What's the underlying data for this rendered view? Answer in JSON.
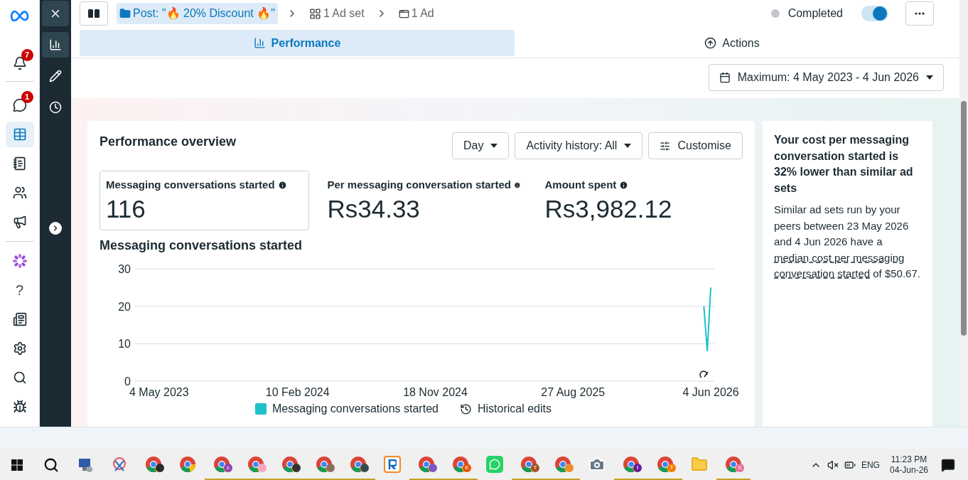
{
  "left_nav": {
    "items": [
      {
        "kind": "logo",
        "selected": false
      },
      {
        "kind": "bell",
        "badge": "7",
        "selected": false
      },
      {
        "kind": "chat",
        "badge": "1",
        "selected": false
      },
      {
        "kind": "table",
        "selected": true
      },
      {
        "kind": "notebook",
        "selected": false
      },
      {
        "kind": "people",
        "selected": false
      },
      {
        "kind": "megaphone",
        "selected": false
      },
      {
        "kind": "flower",
        "selected": false
      },
      {
        "kind": "glyph",
        "glyph": "?",
        "selected": false
      },
      {
        "kind": "news",
        "selected": false
      },
      {
        "kind": "gear",
        "selected": false
      },
      {
        "kind": "search",
        "selected": false
      },
      {
        "kind": "bug",
        "selected": false
      }
    ]
  },
  "rail": {
    "items": [
      {
        "kind": "chart",
        "selected": true
      },
      {
        "kind": "pencil",
        "selected": false
      },
      {
        "kind": "clock",
        "selected": false
      }
    ]
  },
  "breadcrumb": [
    {
      "kind": "post",
      "label": "Post: \"🔥 20% Discount 🔥\"",
      "selected": true
    },
    {
      "kind": "adset",
      "label": "1 Ad set",
      "selected": false
    },
    {
      "kind": "ad",
      "label": "1 Ad",
      "selected": false
    }
  ],
  "status": {
    "label": "Completed",
    "on": true
  },
  "tabs": [
    {
      "kind": "chart",
      "label": "Performance",
      "selected": true
    },
    {
      "kind": "up",
      "label": "Actions",
      "selected": false
    }
  ],
  "date_range": "Maximum: 4 May 2023 - 4 Jun 2026",
  "overview": {
    "title": "Performance overview",
    "controls": [
      {
        "kind": "dropdown",
        "label": "Day"
      },
      {
        "kind": "dropdown",
        "label": "Activity history: All"
      },
      {
        "kind": "button",
        "label": "Customise"
      }
    ],
    "metrics": [
      {
        "label": "Messaging conversations started",
        "value": "116",
        "selected": true
      },
      {
        "label": "Per messaging conversation started",
        "value": "Rs34.33",
        "selected": false
      },
      {
        "label": "Amount spent",
        "value": "Rs3,982.12",
        "selected": false
      }
    ],
    "chart_title": "Messaging conversations started",
    "chart_data": {
      "type": "line",
      "categories": [
        "4 May 2023",
        null,
        null,
        null,
        null,
        null,
        null,
        null,
        null,
        null,
        null,
        null,
        null,
        null,
        null,
        null,
        null,
        null,
        null,
        null,
        null,
        null,
        null,
        null,
        null,
        null,
        null,
        null,
        null,
        null,
        null,
        null,
        null,
        null,
        null,
        null,
        null,
        null,
        null,
        null,
        "10 Feb 2024",
        null,
        null,
        null,
        null,
        null,
        null,
        null,
        null,
        null,
        null,
        null,
        null,
        null,
        null,
        null,
        null,
        null,
        null,
        null,
        null,
        null,
        null,
        null,
        null,
        null,
        null,
        null,
        null,
        null,
        null,
        null,
        null,
        null,
        null,
        null,
        null,
        null,
        null,
        null,
        "18 Nov 2024",
        null,
        null,
        null,
        null,
        null,
        null,
        null,
        null,
        null,
        null,
        null,
        null,
        null,
        null,
        null,
        null,
        null,
        null,
        null,
        null,
        null,
        null,
        null,
        null,
        null,
        null,
        null,
        null,
        null,
        null,
        null,
        null,
        null,
        null,
        null,
        null,
        null,
        null,
        null,
        "27 Aug 2025",
        null,
        null,
        null,
        null,
        null,
        null,
        null,
        null,
        null,
        null,
        null,
        null,
        null,
        null,
        null,
        null,
        null,
        null,
        null,
        null,
        null,
        null,
        null,
        null,
        null,
        null,
        null,
        null,
        null,
        null,
        null,
        null,
        null,
        null,
        null,
        null,
        null,
        null,
        null,
        "4 Jun 2026"
      ],
      "yticks": [
        0,
        10,
        20,
        30
      ],
      "ylim": [
        0,
        30
      ],
      "series": [
        {
          "name": "Messaging conversations started",
          "color": "#1fc1c9",
          "values": [
            null,
            null,
            null,
            null,
            null,
            null,
            null,
            null,
            null,
            null,
            null,
            null,
            null,
            null,
            null,
            null,
            null,
            null,
            null,
            null,
            null,
            null,
            null,
            null,
            null,
            null,
            null,
            null,
            null,
            null,
            null,
            null,
            null,
            null,
            null,
            null,
            null,
            null,
            null,
            null,
            null,
            null,
            null,
            null,
            null,
            null,
            null,
            null,
            null,
            null,
            null,
            null,
            null,
            null,
            null,
            null,
            null,
            null,
            null,
            null,
            null,
            null,
            null,
            null,
            null,
            null,
            null,
            null,
            null,
            null,
            null,
            null,
            null,
            null,
            null,
            null,
            null,
            null,
            null,
            null,
            null,
            null,
            null,
            null,
            null,
            null,
            null,
            null,
            null,
            null,
            null,
            null,
            null,
            null,
            null,
            null,
            null,
            null,
            null,
            null,
            null,
            null,
            null,
            null,
            null,
            null,
            null,
            null,
            null,
            null,
            null,
            null,
            null,
            null,
            null,
            null,
            null,
            null,
            null,
            null,
            null,
            null,
            null,
            null,
            null,
            null,
            null,
            null,
            null,
            null,
            null,
            null,
            null,
            null,
            null,
            null,
            null,
            null,
            null,
            null,
            null,
            null,
            null,
            null,
            null,
            null,
            null,
            null,
            null,
            null,
            null,
            null,
            null,
            null,
            null,
            null,
            null,
            null,
            20,
            8,
            25
          ]
        }
      ]
    },
    "legend_history": "Historical edits"
  },
  "insight": {
    "title": "Your cost per messaging conversation started is 32% lower than similar ad sets",
    "body": "Similar ad sets run by your peers between 23 May 2026 and 4 Jun 2026 have a",
    "link": [
      "median cost per messaging",
      "conversation started"
    ],
    "tail": "of $50.67."
  },
  "taskbar": {
    "apps": [
      {
        "kind": "browser",
        "color": "#2b2b2b",
        "open": false
      },
      {
        "kind": "browser",
        "open": false
      },
      {
        "kind": "browser",
        "color": "#8e44ad",
        "badge": "c",
        "open": true
      },
      {
        "kind": "browser",
        "color": "#f4a6c0",
        "open": true
      },
      {
        "kind": "browser",
        "color": "#333333",
        "open": true
      },
      {
        "kind": "browser",
        "color": "#8d6e63",
        "open": true
      },
      {
        "kind": "browser",
        "color": "#37474f",
        "open": true
      },
      {
        "kind": "r-app",
        "open": false
      },
      {
        "kind": "browser",
        "color": "#7e57c2",
        "open": true
      },
      {
        "kind": "browser",
        "color": "#e65100",
        "badge": "K",
        "open": true
      },
      {
        "kind": "chat-app",
        "open": false
      },
      {
        "kind": "browser",
        "color": "#a0522d",
        "badge": "T",
        "open": true
      },
      {
        "kind": "browser",
        "color": "#ef8f2b",
        "open": true
      },
      {
        "kind": "camera",
        "open": false
      },
      {
        "kind": "browser",
        "color": "#6a1b9a",
        "badge": "t",
        "open": true
      },
      {
        "kind": "browser",
        "color": "#f57c00",
        "badge": "T",
        "open": true
      },
      {
        "kind": "folder",
        "open": false
      },
      {
        "kind": "browser",
        "color": "#ec6b9e",
        "badge": "S",
        "open": true
      }
    ],
    "language": "ENG",
    "time": "11:23 PM",
    "date": "04-Jun-26"
  }
}
